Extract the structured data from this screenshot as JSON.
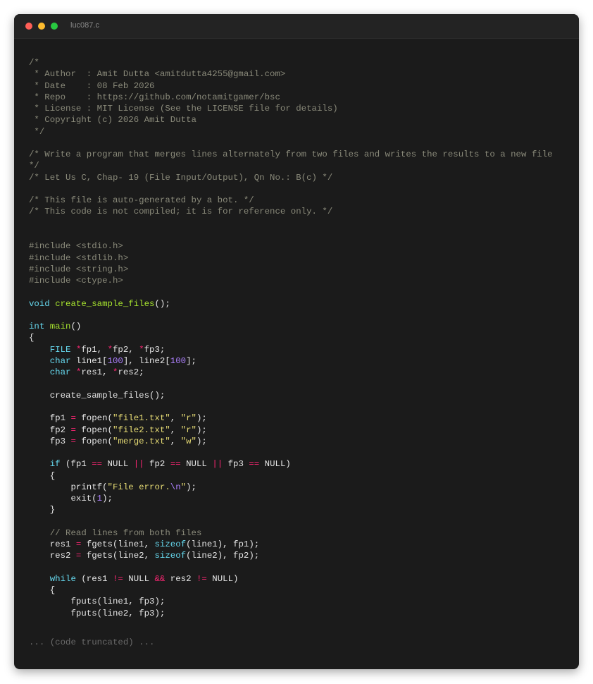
{
  "window": {
    "title": "luc087.c"
  },
  "code_lines": [
    [
      {
        "t": "/*",
        "c": "cm"
      }
    ],
    [
      {
        "t": " * Author  : Amit Dutta <amitdutta4255@gmail.com>",
        "c": "cm"
      }
    ],
    [
      {
        "t": " * Date    : 08 Feb 2026",
        "c": "cm"
      }
    ],
    [
      {
        "t": " * Repo    : https://github.com/notamitgamer/bsc",
        "c": "cm"
      }
    ],
    [
      {
        "t": " * License : MIT License (See the LICENSE file for details)",
        "c": "cm"
      }
    ],
    [
      {
        "t": " * Copyright (c) 2026 Amit Dutta",
        "c": "cm"
      }
    ],
    [
      {
        "t": " */",
        "c": "cm"
      }
    ],
    [],
    [
      {
        "t": "/* Write a program that merges lines alternately from two files and writes the results to a new file",
        "c": "cm"
      }
    ],
    [
      {
        "t": "*/",
        "c": "cm"
      }
    ],
    [
      {
        "t": "/* Let Us C, Chap- 19 (File Input/Output), Qn No.: B(c) */",
        "c": "cm"
      }
    ],
    [],
    [
      {
        "t": "/* This file is auto-generated by a bot. */",
        "c": "cm"
      }
    ],
    [
      {
        "t": "/* This code is not compiled; it is for reference only. */",
        "c": "cm"
      }
    ],
    [],
    [],
    [
      {
        "t": "#include <stdio.h>",
        "c": "pp"
      }
    ],
    [
      {
        "t": "#include <stdlib.h>",
        "c": "pp"
      }
    ],
    [
      {
        "t": "#include <string.h>",
        "c": "pp"
      }
    ],
    [
      {
        "t": "#include <ctype.h>",
        "c": "pp"
      }
    ],
    [],
    [
      {
        "t": "void",
        "c": "kw"
      },
      {
        "t": " "
      },
      {
        "t": "create_sample_files",
        "c": "fn"
      },
      {
        "t": "();"
      }
    ],
    [],
    [
      {
        "t": "int",
        "c": "kw"
      },
      {
        "t": " "
      },
      {
        "t": "main",
        "c": "fn"
      },
      {
        "t": "()"
      }
    ],
    [
      {
        "t": "{"
      }
    ],
    [
      {
        "t": "    "
      },
      {
        "t": "FILE",
        "c": "kw"
      },
      {
        "t": " "
      },
      {
        "t": "*",
        "c": "op"
      },
      {
        "t": "fp1, "
      },
      {
        "t": "*",
        "c": "op"
      },
      {
        "t": "fp2, "
      },
      {
        "t": "*",
        "c": "op"
      },
      {
        "t": "fp3;"
      }
    ],
    [
      {
        "t": "    "
      },
      {
        "t": "char",
        "c": "kw"
      },
      {
        "t": " line1["
      },
      {
        "t": "100",
        "c": "num"
      },
      {
        "t": "], line2["
      },
      {
        "t": "100",
        "c": "num"
      },
      {
        "t": "];"
      }
    ],
    [
      {
        "t": "    "
      },
      {
        "t": "char",
        "c": "kw"
      },
      {
        "t": " "
      },
      {
        "t": "*",
        "c": "op"
      },
      {
        "t": "res1, "
      },
      {
        "t": "*",
        "c": "op"
      },
      {
        "t": "res2;"
      }
    ],
    [],
    [
      {
        "t": "    create_sample_files();"
      }
    ],
    [],
    [
      {
        "t": "    fp1 "
      },
      {
        "t": "=",
        "c": "op"
      },
      {
        "t": " fopen("
      },
      {
        "t": "\"file1.txt\"",
        "c": "str"
      },
      {
        "t": ", "
      },
      {
        "t": "\"r\"",
        "c": "str"
      },
      {
        "t": ");"
      }
    ],
    [
      {
        "t": "    fp2 "
      },
      {
        "t": "=",
        "c": "op"
      },
      {
        "t": " fopen("
      },
      {
        "t": "\"file2.txt\"",
        "c": "str"
      },
      {
        "t": ", "
      },
      {
        "t": "\"r\"",
        "c": "str"
      },
      {
        "t": ");"
      }
    ],
    [
      {
        "t": "    fp3 "
      },
      {
        "t": "=",
        "c": "op"
      },
      {
        "t": " fopen("
      },
      {
        "t": "\"merge.txt\"",
        "c": "str"
      },
      {
        "t": ", "
      },
      {
        "t": "\"w\"",
        "c": "str"
      },
      {
        "t": ");"
      }
    ],
    [],
    [
      {
        "t": "    "
      },
      {
        "t": "if",
        "c": "kw"
      },
      {
        "t": " (fp1 "
      },
      {
        "t": "==",
        "c": "op"
      },
      {
        "t": " NULL "
      },
      {
        "t": "||",
        "c": "op"
      },
      {
        "t": " fp2 "
      },
      {
        "t": "==",
        "c": "op"
      },
      {
        "t": " NULL "
      },
      {
        "t": "||",
        "c": "op"
      },
      {
        "t": " fp3 "
      },
      {
        "t": "==",
        "c": "op"
      },
      {
        "t": " NULL)"
      }
    ],
    [
      {
        "t": "    {"
      }
    ],
    [
      {
        "t": "        printf("
      },
      {
        "t": "\"File error.",
        "c": "str"
      },
      {
        "t": "\\n",
        "c": "esc"
      },
      {
        "t": "\"",
        "c": "str"
      },
      {
        "t": ");"
      }
    ],
    [
      {
        "t": "        exit("
      },
      {
        "t": "1",
        "c": "num"
      },
      {
        "t": ");"
      }
    ],
    [
      {
        "t": "    }"
      }
    ],
    [],
    [
      {
        "t": "    // Read lines from both files",
        "c": "cm"
      }
    ],
    [
      {
        "t": "    res1 "
      },
      {
        "t": "=",
        "c": "op"
      },
      {
        "t": " fgets(line1, "
      },
      {
        "t": "sizeof",
        "c": "kw"
      },
      {
        "t": "(line1), fp1);"
      }
    ],
    [
      {
        "t": "    res2 "
      },
      {
        "t": "=",
        "c": "op"
      },
      {
        "t": " fgets(line2, "
      },
      {
        "t": "sizeof",
        "c": "kw"
      },
      {
        "t": "(line2), fp2);"
      }
    ],
    [],
    [
      {
        "t": "    "
      },
      {
        "t": "while",
        "c": "kw"
      },
      {
        "t": " (res1 "
      },
      {
        "t": "!=",
        "c": "op"
      },
      {
        "t": " NULL "
      },
      {
        "t": "&&",
        "c": "op"
      },
      {
        "t": " res2 "
      },
      {
        "t": "!=",
        "c": "op"
      },
      {
        "t": " NULL)"
      }
    ],
    [
      {
        "t": "    {"
      }
    ],
    [
      {
        "t": "        fputs(line1, fp3);"
      }
    ],
    [
      {
        "t": "        fputs(line2, fp3);"
      }
    ]
  ],
  "truncation_note": "... (code truncated) ...",
  "colors": {
    "background": "#1b1b1b",
    "comment": "#8a8a7a",
    "keyword": "#66d9ef",
    "function": "#a6e22e",
    "operator": "#f92672",
    "string": "#e6db74",
    "number": "#ae81ff"
  }
}
